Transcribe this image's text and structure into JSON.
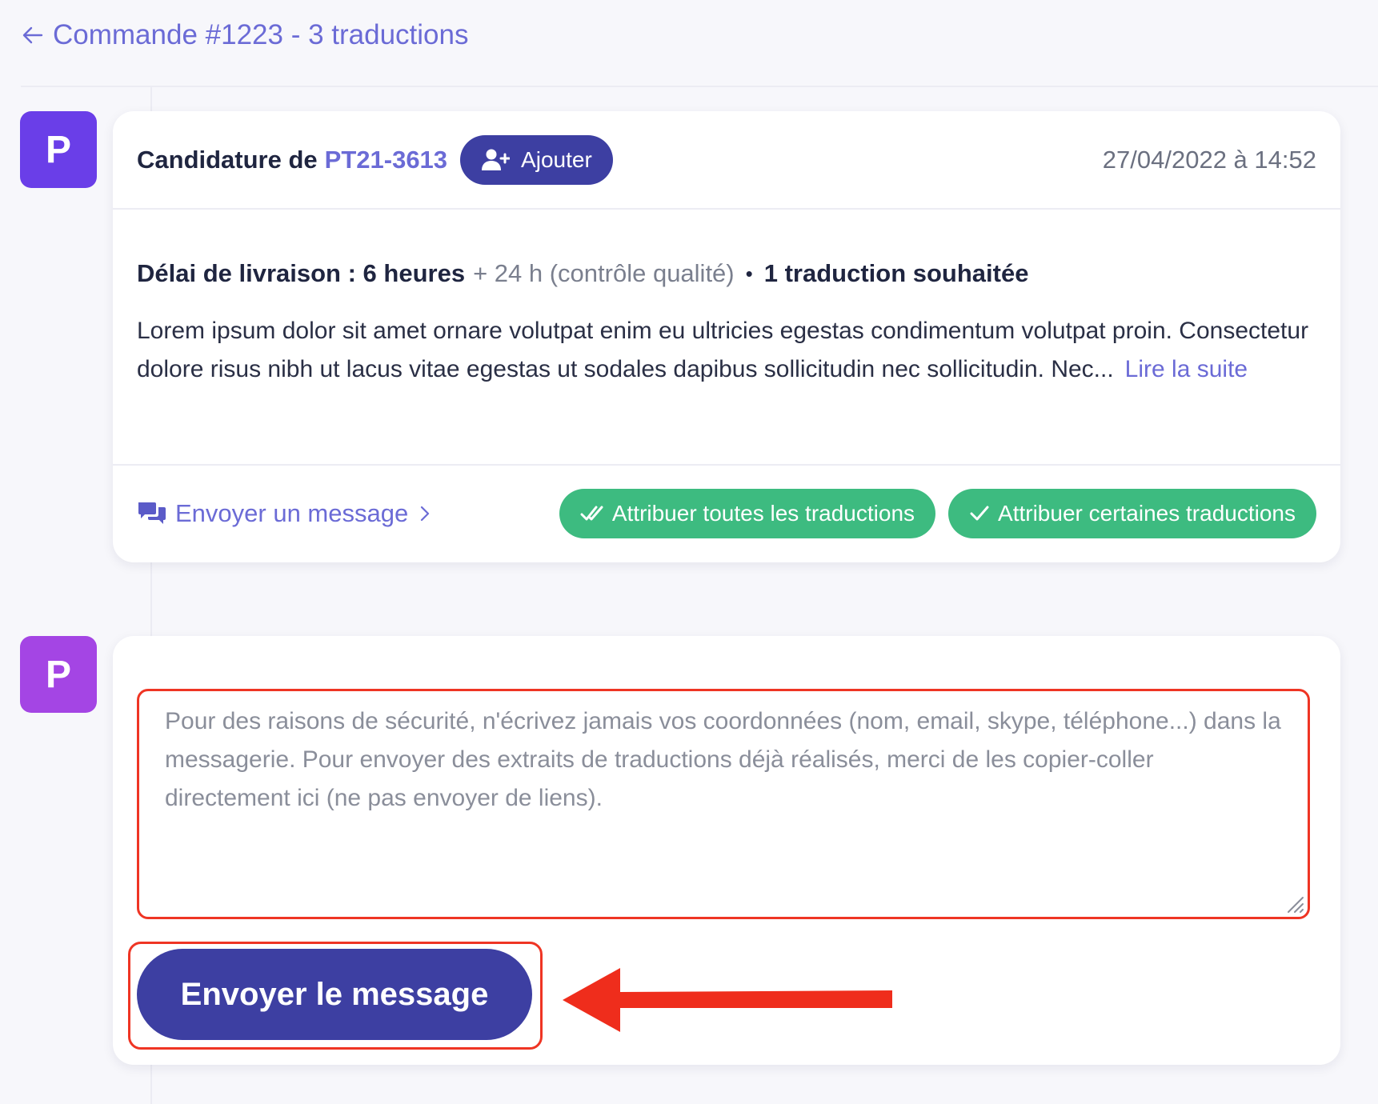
{
  "header": {
    "back_label": "Commande #1223 - 3 traductions"
  },
  "application": {
    "avatar_letter": "P",
    "title_prefix": "Candidature de",
    "translator_code": "PT21-3613",
    "add_button_label": "Ajouter",
    "date": "27/04/2022 à 14:52",
    "delivery_label": "Délai de livraison : 6 heures",
    "quality_check": "+ 24 h (contrôle qualité)",
    "separator": "•",
    "translations_wanted": "1 traduction souhaitée",
    "description": "Lorem ipsum dolor sit amet ornare volutpat enim eu ultricies egestas condimentum volutpat proin. Consectetur dolore risus nibh ut lacus vitae egestas ut sodales dapibus sollicitudin nec sollicitudin. Nec...",
    "read_more": "Lire la suite",
    "send_message_link": "Envoyer un message",
    "assign_all_label": "Attribuer toutes les traductions",
    "assign_some_label": "Attribuer certaines traductions"
  },
  "composer": {
    "avatar_letter": "P",
    "value": "",
    "placeholder": "Pour des raisons de sécurité, n'écrivez jamais vos coordonnées (nom, email, skype, téléphone...) dans la messagerie. Pour envoyer des extraits de traductions déjà réalisés, merci de les copier-coller directement ici (ne pas envoyer de liens).",
    "send_button_label": "Envoyer le message"
  },
  "colors": {
    "primary": "#3d3fa2",
    "link": "#6b6bd6",
    "success": "#3dbb80",
    "highlight": "#ef3524",
    "avatar_1": "#6a3ee8",
    "avatar_2": "#a445e4"
  },
  "icons": {
    "back": "arrow-left-icon",
    "add": "user-plus-icon",
    "message": "chat-bubbles-icon",
    "chevron": "chevron-right-icon",
    "assign_all": "double-check-icon",
    "assign_some": "check-icon",
    "annotation": "red-arrow-icon"
  }
}
